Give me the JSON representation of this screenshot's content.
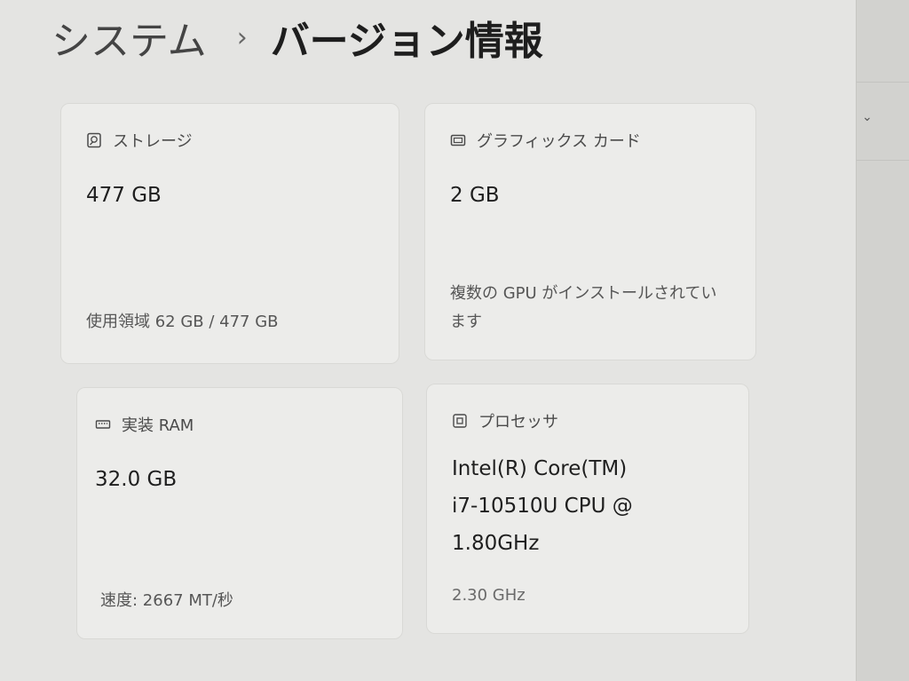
{
  "breadcrumb": {
    "parent": "システム",
    "separator": "›",
    "current": "バージョン情報"
  },
  "cards": {
    "storage": {
      "icon": "hard-drive-icon",
      "title": "ストレージ",
      "value": "477 GB",
      "detail": "使用領域 62 GB / 477 GB"
    },
    "graphics": {
      "icon": "display-adapter-icon",
      "title": "グラフィックス カード",
      "value": "2 GB",
      "detail_line1": "複数の GPU がインストールされてい",
      "detail_line2": "ます"
    },
    "ram": {
      "icon": "memory-icon",
      "title": "実装 RAM",
      "value": "32.0 GB",
      "detail": "速度: 2667 MT/秒"
    },
    "processor": {
      "icon": "cpu-chip-icon",
      "title": "プロセッサ",
      "value_line1": "Intel(R) Core(TM)",
      "value_line2": "i7-10510U CPU @",
      "value_line3": "1.80GHz",
      "detail": "2.30 GHz"
    }
  }
}
